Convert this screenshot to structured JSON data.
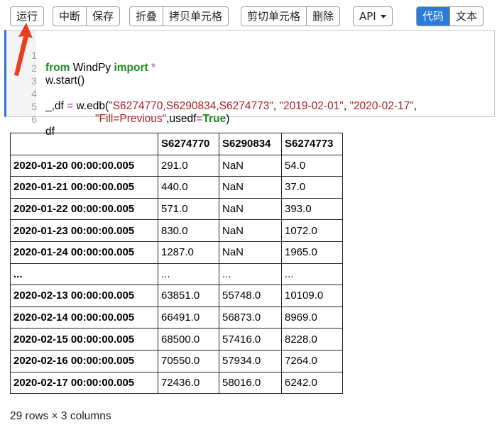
{
  "toolbar": {
    "run": "运行",
    "interrupt": "中断",
    "save": "保存",
    "fold": "折叠",
    "copy_cell": "拷贝单元格",
    "cut_cell": "剪切单元格",
    "delete": "删除",
    "api": "API",
    "mode_code": "代码",
    "mode_text": "文本"
  },
  "code": {
    "lines": [
      {
        "num": "1"
      },
      {
        "num": "2"
      },
      {
        "num": "3"
      },
      {
        "num": "4"
      },
      {
        "num": "5"
      },
      {
        "num": "6"
      }
    ],
    "l1_from": "from",
    "l1_mod": " WindPy ",
    "l1_import": "import",
    "l1_star": " *",
    "l2": "w.start()",
    "l4_a": "_,df ",
    "l4_eq": "=",
    "l4_b": " w.edb(",
    "l4_s1": "\"S6274770,S6290834,S6274773\"",
    "l4_c1": ", ",
    "l4_s2": "\"2019-02-01\"",
    "l4_c2": ", ",
    "l4_s3": "\"2020-02-17\"",
    "l4_c3": ",",
    "l5_s": "\"Fill=Previous\"",
    "l5_a": ",usedf",
    "l5_eq": "=",
    "l5_true": "True",
    "l5_close": ")",
    "l6": "df"
  },
  "table": {
    "columns": [
      "",
      "S6274770",
      "S6290834",
      "S6274773"
    ],
    "rows": [
      [
        "2020-01-20 00:00:00.005",
        "291.0",
        "NaN",
        "54.0"
      ],
      [
        "2020-01-21 00:00:00.005",
        "440.0",
        "NaN",
        "37.0"
      ],
      [
        "2020-01-22 00:00:00.005",
        "571.0",
        "NaN",
        "393.0"
      ],
      [
        "2020-01-23 00:00:00.005",
        "830.0",
        "NaN",
        "1072.0"
      ],
      [
        "2020-01-24 00:00:00.005",
        "1287.0",
        "NaN",
        "1965.0"
      ],
      [
        "...",
        "...",
        "...",
        "..."
      ],
      [
        "2020-02-13 00:00:00.005",
        "63851.0",
        "55748.0",
        "10109.0"
      ],
      [
        "2020-02-14 00:00:00.005",
        "66491.0",
        "56873.0",
        "8969.0"
      ],
      [
        "2020-02-15 00:00:00.005",
        "68500.0",
        "57416.0",
        "8228.0"
      ],
      [
        "2020-02-16 00:00:00.005",
        "70550.0",
        "57934.0",
        "7264.0"
      ],
      [
        "2020-02-17 00:00:00.005",
        "72436.0",
        "58016.0",
        "6242.0"
      ]
    ],
    "footer": "29 rows × 3 columns"
  },
  "colors": {
    "accent": "#2a7ad9",
    "keyword": "#1d8a1d",
    "string": "#b02020",
    "operator": "#b232b2",
    "arrow": "#e8401c"
  }
}
